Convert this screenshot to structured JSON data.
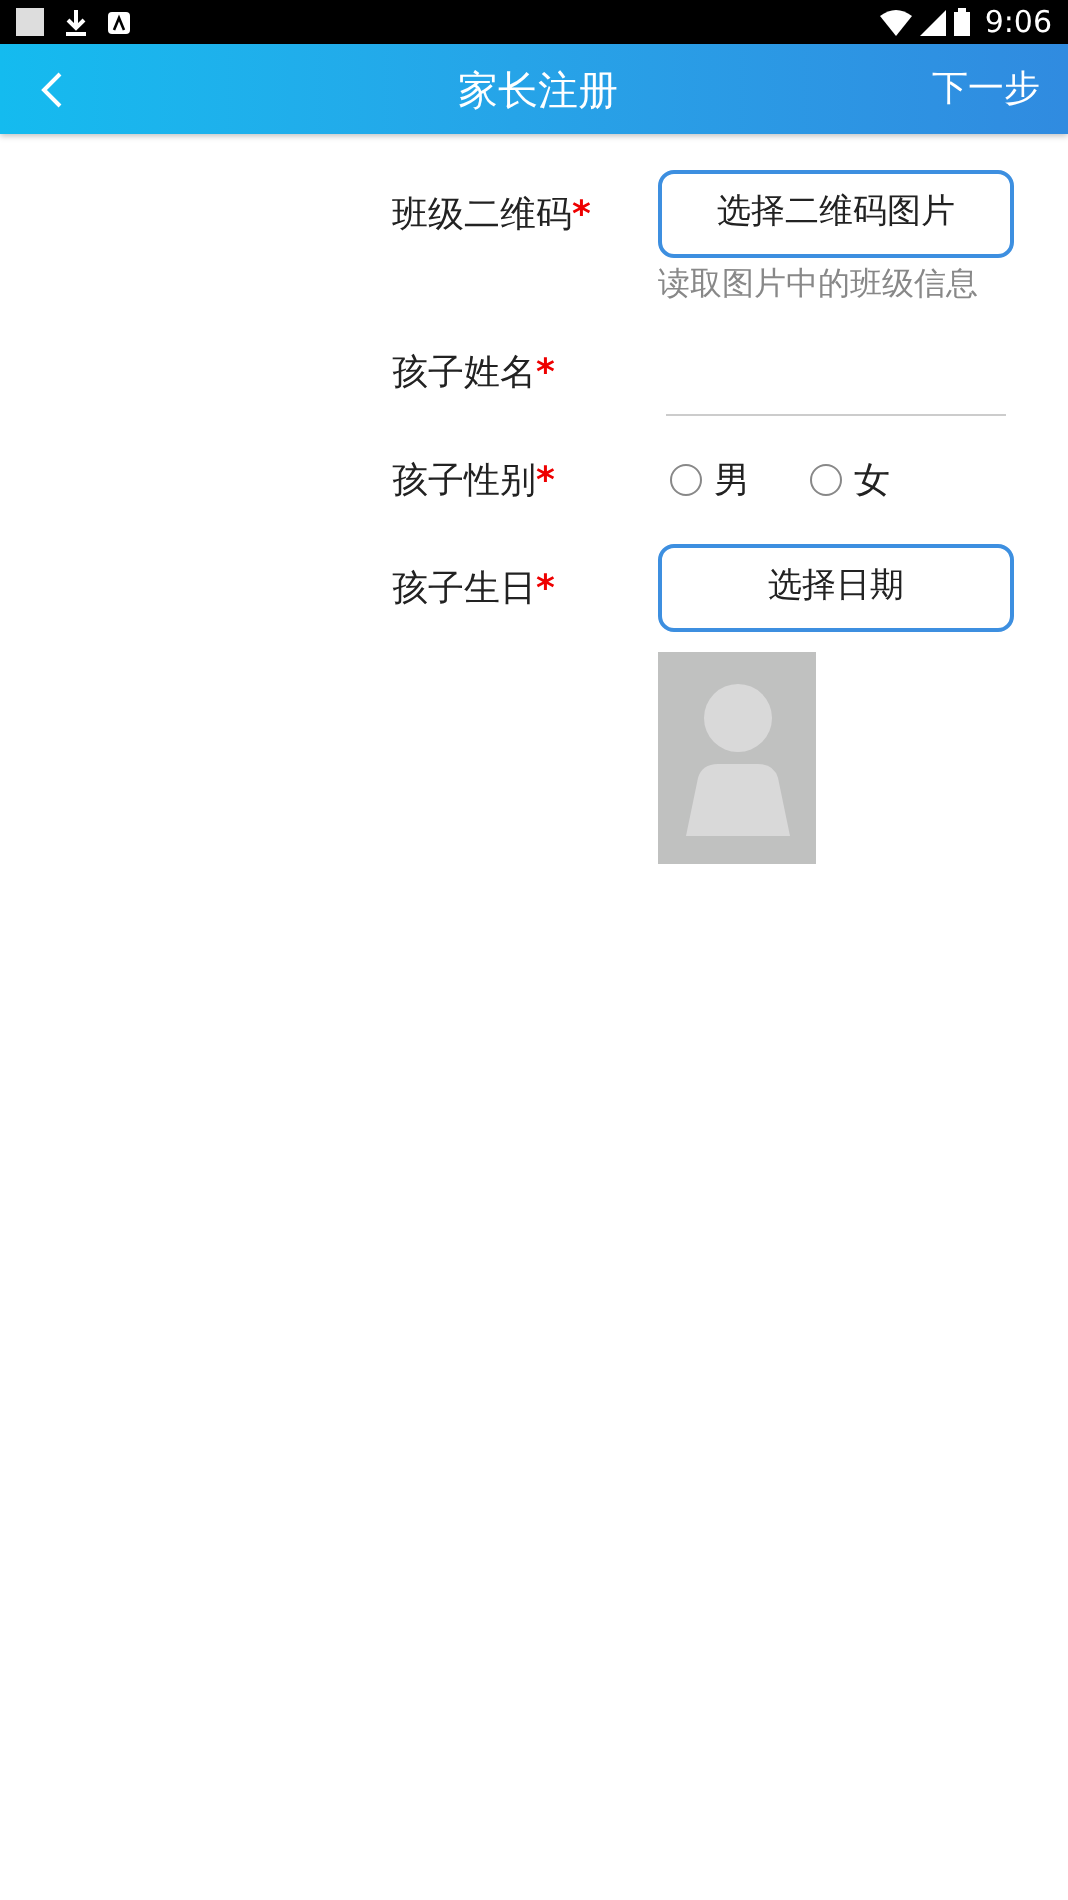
{
  "status_bar": {
    "time": "9:06"
  },
  "header": {
    "title": "家长注册",
    "action": "下一步"
  },
  "form": [
    {
      "kind": "button",
      "label": "班级二维码",
      "mark": "*",
      "button": "选择二维码图片",
      "hint": "读取图片中的班级信息"
    },
    {
      "kind": "text",
      "label": "孩子姓名",
      "mark": "*"
    },
    {
      "kind": "radio",
      "label": "孩子性别",
      "mark": "*",
      "options": [
        {
          "label": "男",
          "selected": false
        },
        {
          "label": "女",
          "selected": false
        }
      ]
    },
    {
      "kind": "button",
      "label": "孩子生日",
      "mark": "*",
      "button": "选择日期"
    }
  ]
}
